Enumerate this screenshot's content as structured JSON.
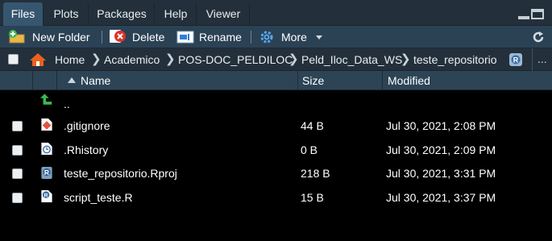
{
  "tabs": [
    {
      "label": "Files",
      "active": true
    },
    {
      "label": "Plots",
      "active": false
    },
    {
      "label": "Packages",
      "active": false
    },
    {
      "label": "Help",
      "active": false
    },
    {
      "label": "Viewer",
      "active": false
    }
  ],
  "toolbar": {
    "new_folder": "New Folder",
    "delete": "Delete",
    "rename": "Rename",
    "more": "More"
  },
  "breadcrumb": {
    "items": [
      "Home",
      "Academico",
      "POS-DOC_PELDILOC",
      "Peld_Iloc_Data_WS",
      "teste_repositorio"
    ],
    "more": "..."
  },
  "columns": {
    "name": "Name",
    "size": "Size",
    "modified": "Modified"
  },
  "parent_dir": "..",
  "files": [
    {
      "name": ".gitignore",
      "size": "44 B",
      "modified": "Jul 30, 2021, 2:08 PM",
      "icon": "git-file-icon"
    },
    {
      "name": ".Rhistory",
      "size": "0 B",
      "modified": "Jul 30, 2021, 2:09 PM",
      "icon": "r-history-icon"
    },
    {
      "name": "teste_repositorio.Rproj",
      "size": "218 B",
      "modified": "Jul 30, 2021, 3:31 PM",
      "icon": "rproj-icon"
    },
    {
      "name": "script_teste.R",
      "size": "15 B",
      "modified": "Jul 30, 2021, 3:37 PM",
      "icon": "r-script-icon"
    }
  ],
  "colors": {
    "tab_bar": "#23303b",
    "active_tab": "#36566f",
    "toolbar": "#2b4255",
    "header": "#2d4456",
    "list_bg": "#000000",
    "home_icon": "#e8621e",
    "up_arrow": "#3fb950"
  }
}
